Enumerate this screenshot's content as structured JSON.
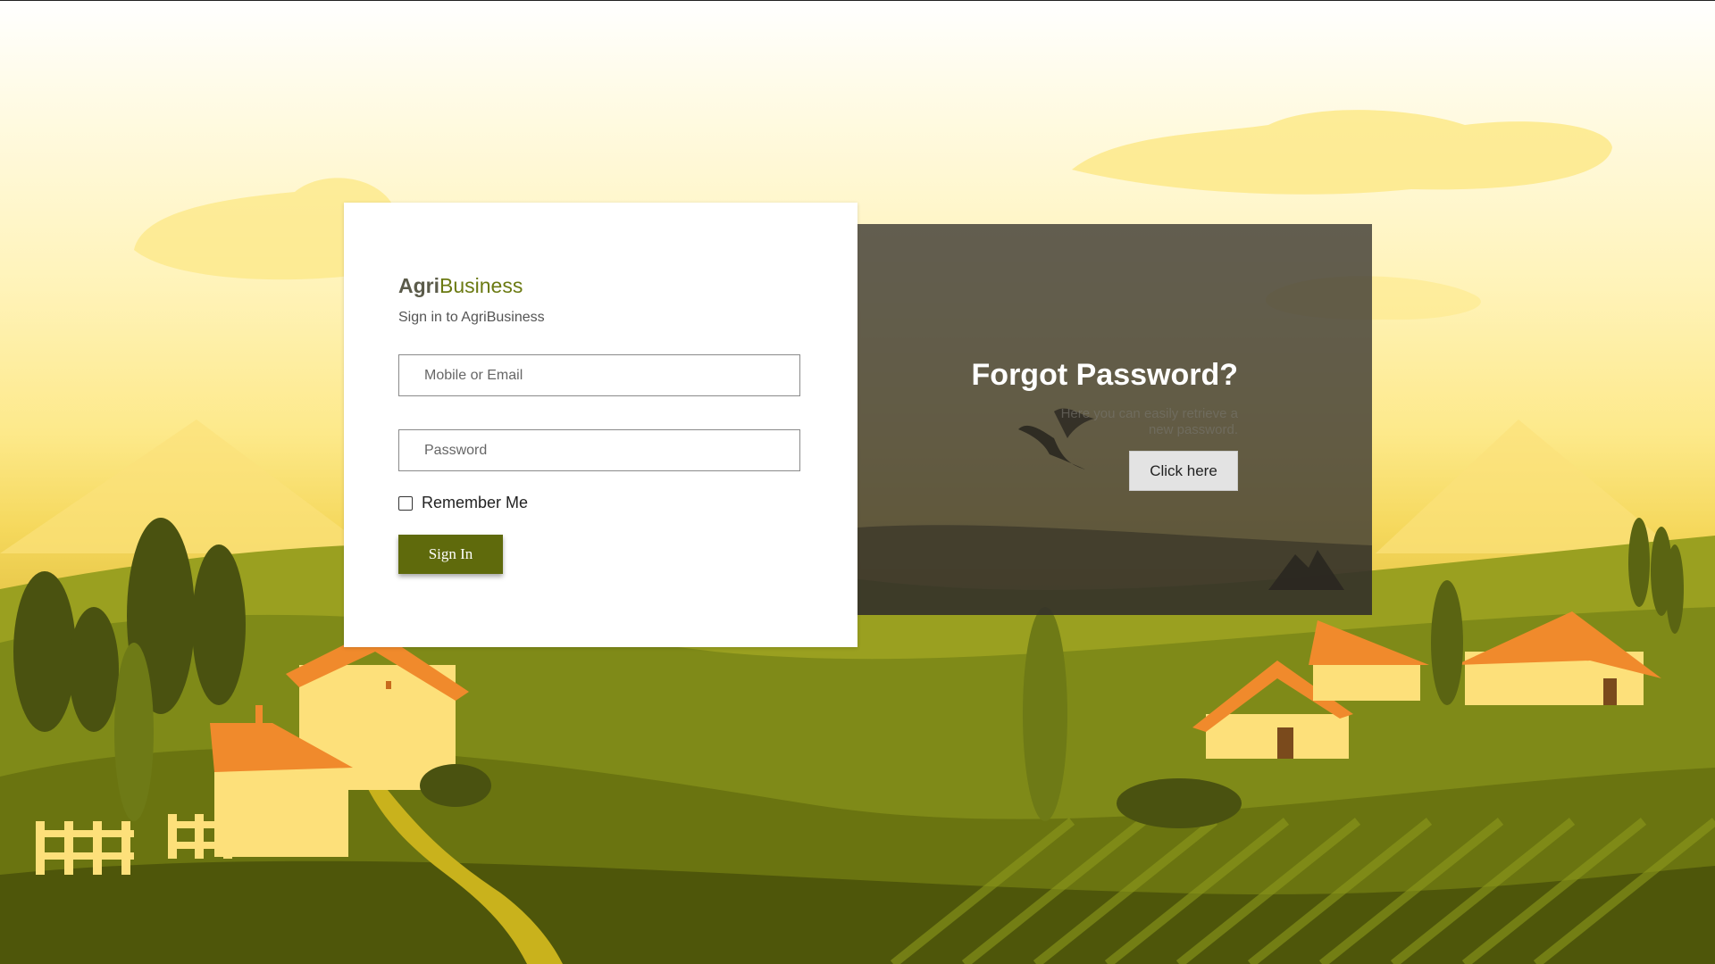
{
  "brand": {
    "part1": "Agri",
    "part2": "Business",
    "subtitle": "Sign in to AgriBusiness"
  },
  "form": {
    "email_placeholder": "Mobile or Email",
    "password_placeholder": "Password",
    "remember_label": "Remember Me",
    "remember_checked": false,
    "signin_label": "Sign In"
  },
  "forgot": {
    "title": "Forgot Password?",
    "description": "Here you can easily retrieve a new password.",
    "button_label": "Click here"
  },
  "colors": {
    "brand_green": "#6b7a12",
    "button_green": "#5f6a0c",
    "panel_overlay": "#403c34",
    "sky": "#fff3b8",
    "roof_orange": "#f08a2c"
  }
}
